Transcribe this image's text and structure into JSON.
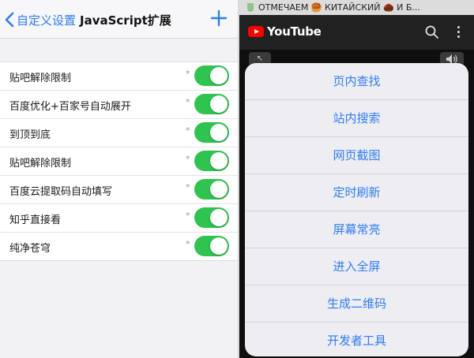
{
  "left": {
    "back_label": "自定义设置",
    "title": "JavaScript扩展",
    "items": [
      {
        "label": "贴吧解除限制",
        "enabled": true
      },
      {
        "label": "百度优化+百家号自动展开",
        "enabled": true
      },
      {
        "label": "到顶到底",
        "enabled": true
      },
      {
        "label": "贴吧解除限制",
        "enabled": true
      },
      {
        "label": "百度云提取码自动填写",
        "enabled": true
      },
      {
        "label": "知乎直接看",
        "enabled": true
      },
      {
        "label": "纯净苍穹",
        "enabled": true
      }
    ],
    "star": "*"
  },
  "right": {
    "marquee_text": "ОТМЕЧАЕМ 🥮 КИТАЙСКИЙ 🌰 И Б...",
    "youtube_label": "YouTube",
    "menu_items": [
      "页内查找",
      "站内搜索",
      "网页截图",
      "定时刷新",
      "屏幕常亮",
      "进入全屏",
      "生成二维码",
      "开发者工具"
    ]
  },
  "colors": {
    "accent": "#2f7bf6",
    "toggle_on": "#2ec44f",
    "youtube_red": "#ff0000"
  },
  "icons": {
    "back": "chevron-left-icon",
    "add": "plus-icon",
    "search": "search-icon",
    "more": "more-vertical-icon",
    "minimize": "minimize-icon",
    "volume": "volume-icon"
  }
}
